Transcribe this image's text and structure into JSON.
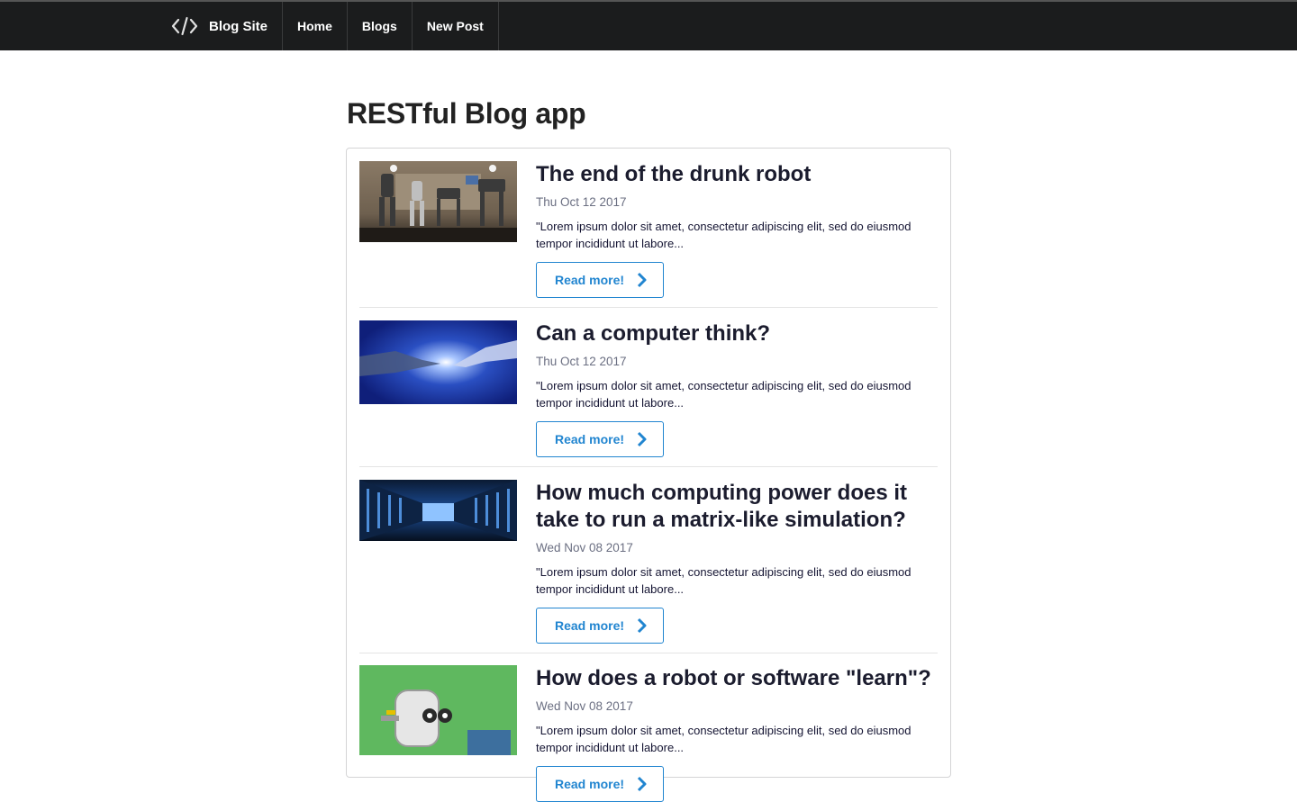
{
  "navbar": {
    "brand_label": "Blog Site",
    "brand_icon": "code-icon",
    "items": [
      {
        "label": "Home"
      },
      {
        "label": "Blogs"
      },
      {
        "label": "New Post"
      }
    ]
  },
  "page": {
    "title": "RESTful Blog app"
  },
  "posts": [
    {
      "title": "The end of the drunk robot",
      "date": "Thu Oct 12 2017",
      "excerpt": "\"Lorem ipsum dolor sit amet, consectetur adipiscing elit, sed do eiusmod tempor incididunt ut labore...",
      "button_label": "Read more!",
      "image": "robots-lineup-photo"
    },
    {
      "title": "Can a computer think?",
      "date": "Thu Oct 12 2017",
      "excerpt": "\"Lorem ipsum dolor sit amet, consectetur adipiscing elit, sed do eiusmod tempor incididunt ut labore...",
      "button_label": "Read more!",
      "image": "robot-human-hands-photo"
    },
    {
      "title": "How much computing power does it take to run a matrix-like simulation?",
      "date": "Wed Nov 08 2017",
      "excerpt": "\"Lorem ipsum dolor sit amet, consectetur adipiscing elit, sed do eiusmod tempor incididunt ut labore...",
      "button_label": "Read more!",
      "image": "server-room-photo"
    },
    {
      "title": "How does a robot or software \"learn\"?",
      "date": "Wed Nov 08 2017",
      "excerpt": "\"Lorem ipsum dolor sit amet, consectetur adipiscing elit, sed do eiusmod tempor incididunt ut labore...",
      "button_label": "Read more!",
      "image": "cartoon-robot-illustration"
    }
  ],
  "colors": {
    "navbar_bg": "#1b1c1d",
    "accent": "#2185d0",
    "title_text": "#1b1c2e",
    "date_text": "#6b6f82"
  }
}
